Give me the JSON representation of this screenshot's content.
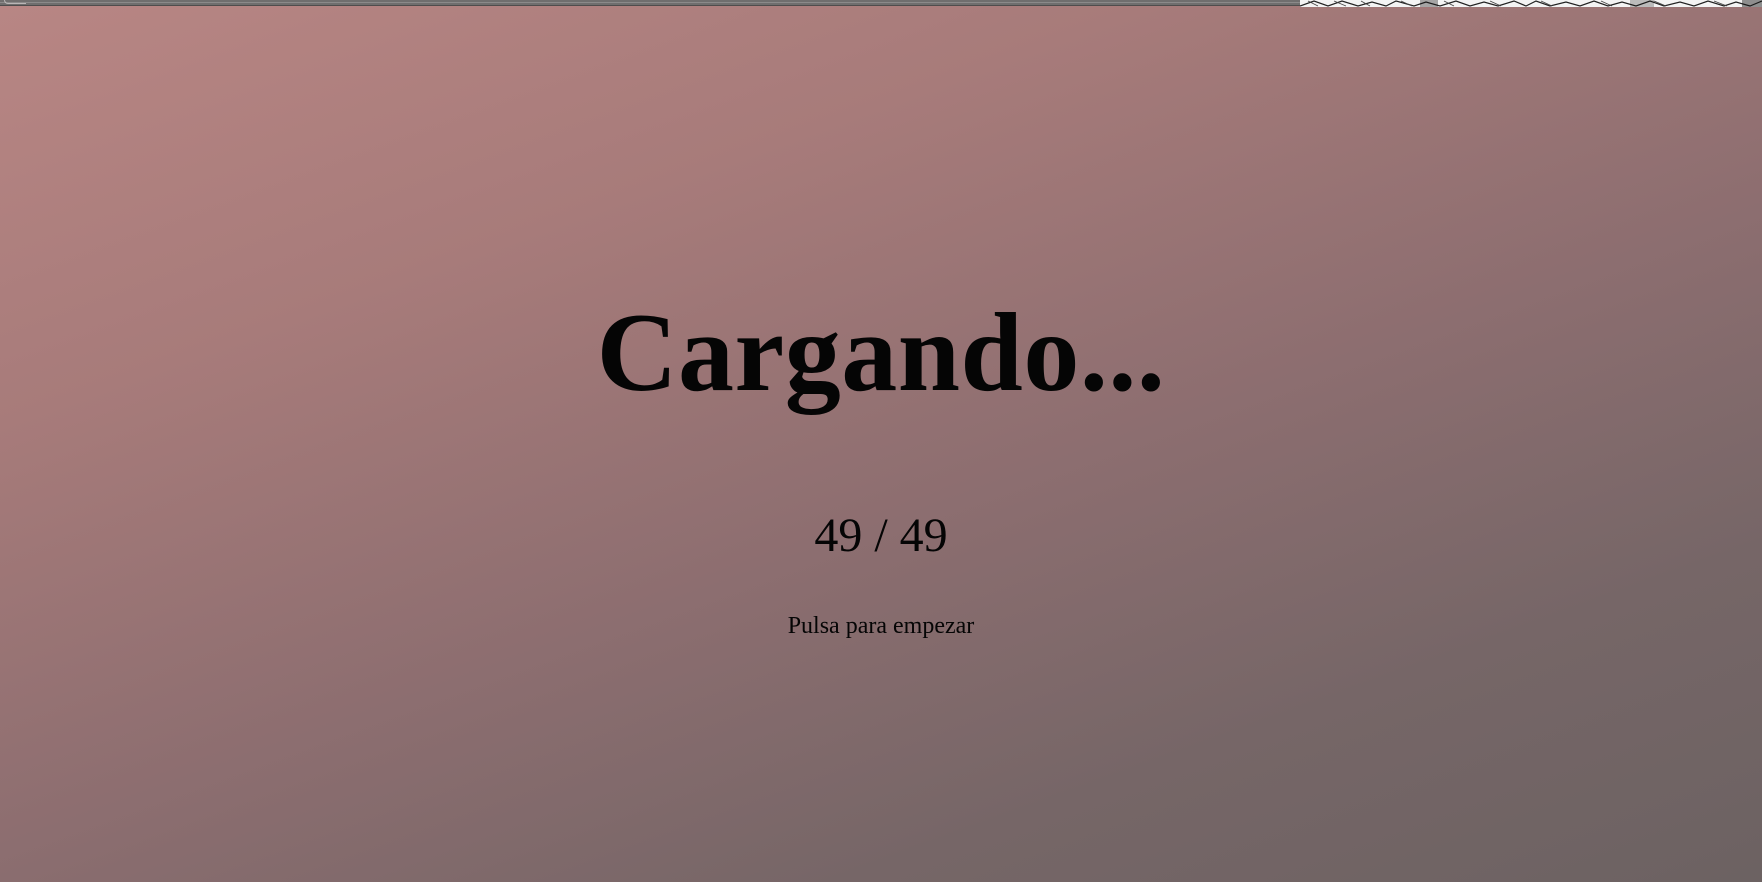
{
  "loading_screen": {
    "title": "Cargando...",
    "progress": {
      "loaded": 49,
      "total": 49,
      "label": "49 / 49"
    },
    "prompt": "Pulsa para empezar"
  },
  "colors": {
    "background_top_left": "#b88684",
    "background_bottom_right": "#6c6262",
    "text": "#050505"
  },
  "icons": {
    "top_strip_art": "sketch-art-strip"
  }
}
